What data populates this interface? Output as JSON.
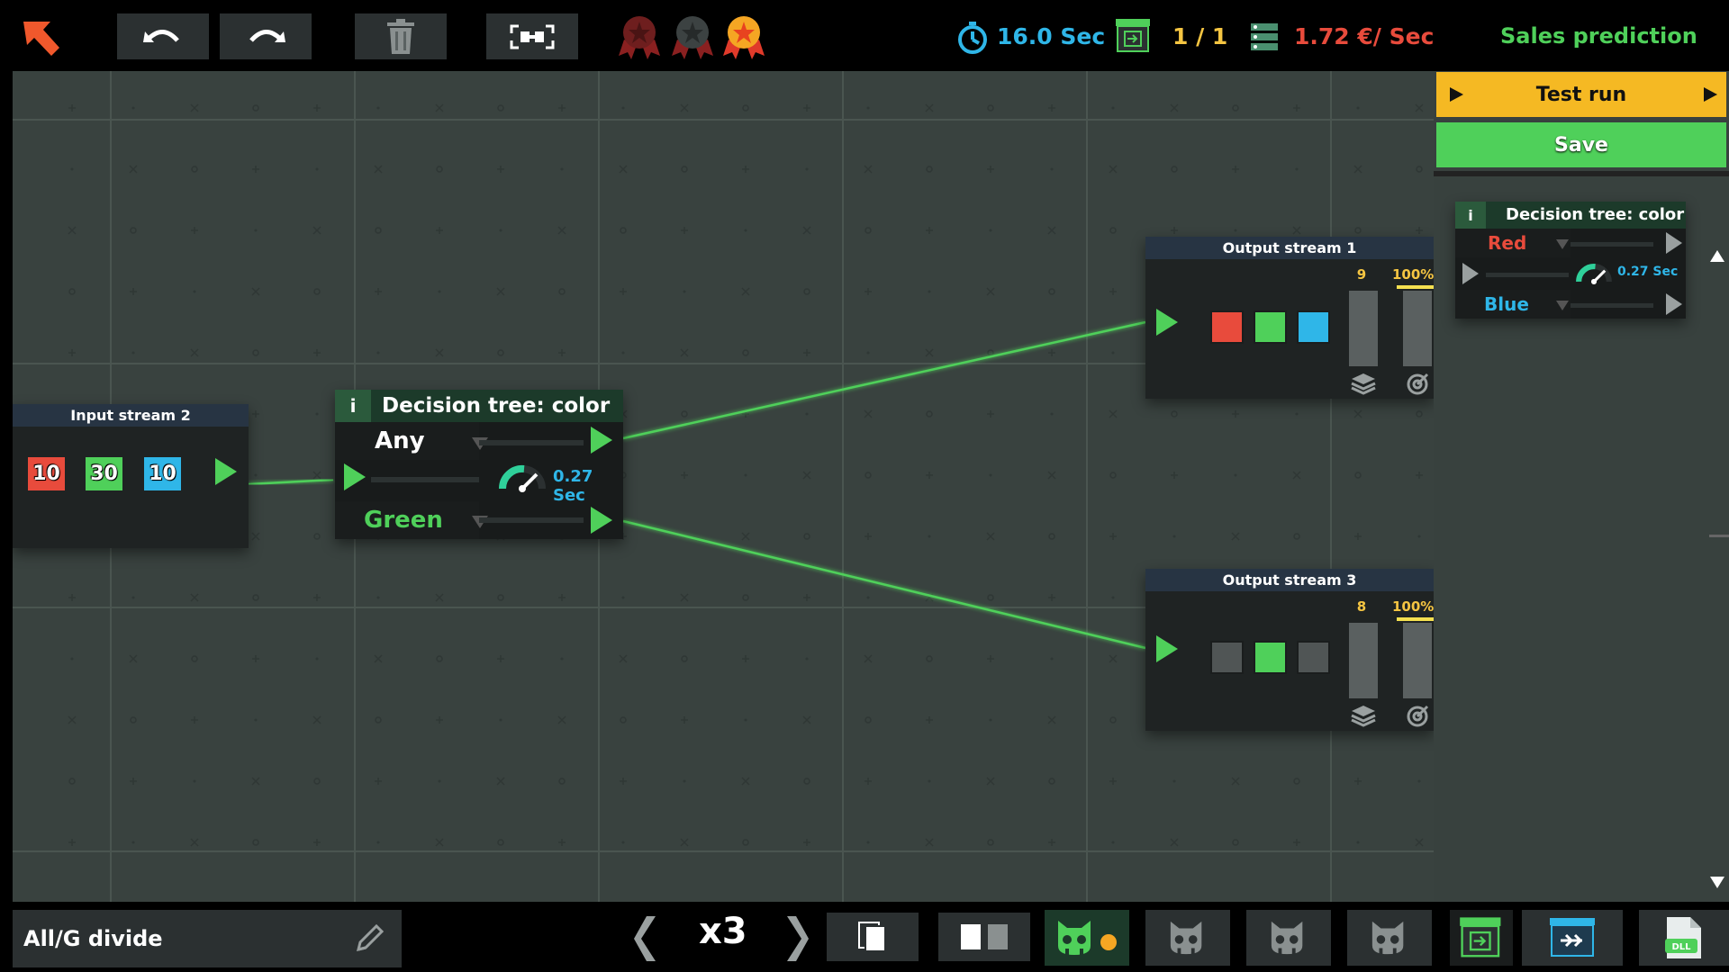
{
  "top_bar": {
    "back_icon": "back-arrow-icon",
    "undo_icon": "undo-icon",
    "redo_icon": "redo-icon",
    "delete_icon": "trash-icon",
    "fit_icon": "fit-view-icon",
    "medals": [
      "bronze-medal-icon",
      "silver-medal-icon",
      "gold-medal-icon"
    ],
    "time_value": "16.0 Sec",
    "time_color": "#2fb6e8",
    "deploy_count": "1 / 1",
    "deploy_color": "#f5c542",
    "cost_value": "1.72 €/ Sec",
    "cost_color": "#e84b3c",
    "level_title": "Sales prediction",
    "level_title_color": "#4fd05a"
  },
  "canvas": {
    "input_node": {
      "title": "Input stream 2",
      "counts": [
        {
          "value": "10",
          "color": "#e84b3c"
        },
        {
          "value": "30",
          "color": "#4fd05a"
        },
        {
          "value": "10",
          "color": "#2fb6e8"
        }
      ]
    },
    "decision_node": {
      "info_label": "i",
      "title": "Decision tree: color",
      "top_option": "Any",
      "bottom_option": "Green",
      "speed": "0.27 Sec"
    },
    "output_1": {
      "title": "Output stream 1",
      "count": "9",
      "percent": "100%",
      "squares": [
        "#e84b3c",
        "#4fd05a",
        "#2fb6e8"
      ]
    },
    "output_3": {
      "title": "Output stream 3",
      "count": "8",
      "percent": "100%",
      "squares": [
        "#505555",
        "#4fd05a",
        "#505555"
      ]
    }
  },
  "right_panel": {
    "test_run_label": "Test run",
    "save_label": "Save",
    "card": {
      "info_label": "i",
      "title": "Decision tree: color",
      "top_option": "Red",
      "bottom_option": "Blue",
      "speed": "0.27 Sec"
    }
  },
  "bottom_bar": {
    "level_name": "All/G divide",
    "speed_multiplier": "x3",
    "edit_icon": "pencil-icon",
    "dll_label": "DLL"
  }
}
